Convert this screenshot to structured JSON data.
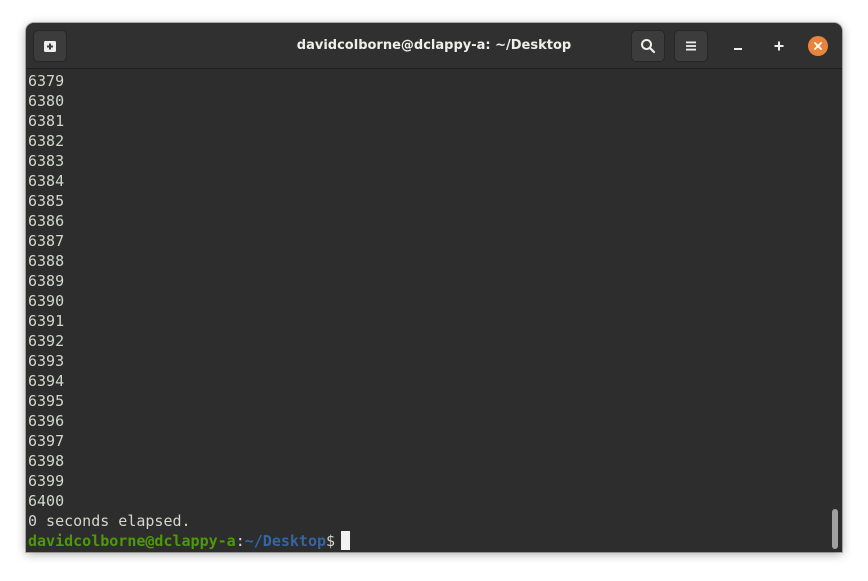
{
  "window": {
    "title": "davidcolborne@dclappy-a: ~/Desktop"
  },
  "headerbar": {
    "new_tab_icon": "new-tab-icon",
    "search_icon": "search-icon",
    "menu_icon": "hamburger-menu-icon",
    "minimize_icon": "minimize-icon",
    "maximize_icon": "maximize-icon",
    "close_icon": "close-icon"
  },
  "terminal": {
    "output_lines": [
      "6379",
      "6380",
      "6381",
      "6382",
      "6383",
      "6384",
      "6385",
      "6386",
      "6387",
      "6388",
      "6389",
      "6390",
      "6391",
      "6392",
      "6393",
      "6394",
      "6395",
      "6396",
      "6397",
      "6398",
      "6399",
      "6400"
    ],
    "status_line": "0 seconds elapsed.",
    "prompt": {
      "user_host": "davidcolborne@dclappy-a",
      "colon": ":",
      "path": "~/Desktop",
      "dollar": "$"
    }
  },
  "colors": {
    "background": "#2d2d2d",
    "text": "#d3d7cf",
    "prompt_user": "#4e9a06",
    "prompt_path": "#3465a4",
    "close_button": "#e8843b"
  }
}
